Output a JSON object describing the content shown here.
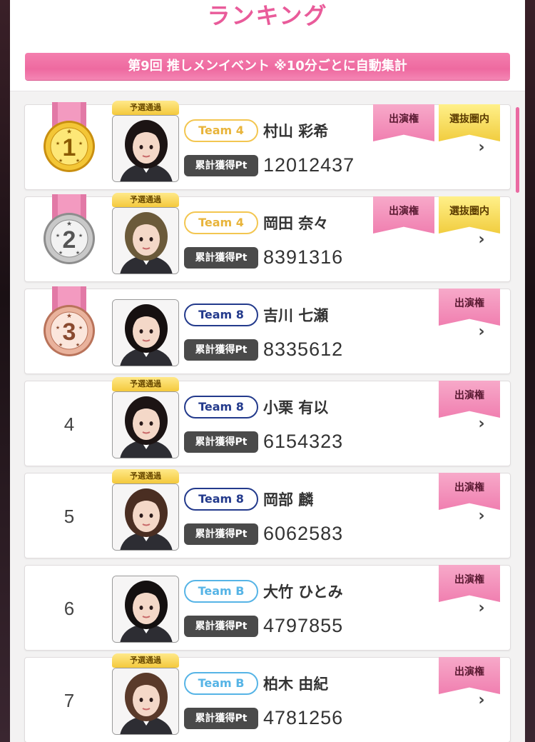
{
  "header": {
    "title": "ランキング",
    "event_label": "第9回 推しメンイベント ※10分ごとに自動集計"
  },
  "pt_label": "累計獲得Pt",
  "colors": {
    "accent": "#e95b9a",
    "team4": "#f3c650",
    "team8": "#233a8c",
    "teamB": "#56b4e6"
  },
  "rankings": [
    {
      "rank": "1",
      "medal": "gold",
      "qualified": true,
      "qualified_label": "予選通過",
      "team": "Team 4",
      "team_color": "#f3c650",
      "team_text_color": "#e8b43a",
      "name": "村山 彩希",
      "points": "12012437",
      "badges": [
        "出演権",
        "選抜圏内"
      ]
    },
    {
      "rank": "2",
      "medal": "silver",
      "qualified": true,
      "qualified_label": "予選通過",
      "team": "Team 4",
      "team_color": "#f3c650",
      "team_text_color": "#e8b43a",
      "name": "岡田 奈々",
      "points": "8391316",
      "badges": [
        "出演権",
        "選抜圏内"
      ]
    },
    {
      "rank": "3",
      "medal": "bronze",
      "qualified": false,
      "qualified_label": "",
      "team": "Team 8",
      "team_color": "#233a8c",
      "team_text_color": "#233a8c",
      "name": "吉川 七瀬",
      "points": "8335612",
      "badges": [
        "出演権"
      ]
    },
    {
      "rank": "4",
      "medal": "",
      "qualified": true,
      "qualified_label": "予選通過",
      "team": "Team 8",
      "team_color": "#233a8c",
      "team_text_color": "#233a8c",
      "name": "小栗 有以",
      "points": "6154323",
      "badges": [
        "出演権"
      ]
    },
    {
      "rank": "5",
      "medal": "",
      "qualified": true,
      "qualified_label": "予選通過",
      "team": "Team 8",
      "team_color": "#233a8c",
      "team_text_color": "#233a8c",
      "name": "岡部 麟",
      "points": "6062583",
      "badges": [
        "出演権"
      ]
    },
    {
      "rank": "6",
      "medal": "",
      "qualified": false,
      "qualified_label": "",
      "team": "Team B",
      "team_color": "#56b4e6",
      "team_text_color": "#56b4e6",
      "name": "大竹 ひとみ",
      "points": "4797855",
      "badges": [
        "出演権"
      ]
    },
    {
      "rank": "7",
      "medal": "",
      "qualified": true,
      "qualified_label": "予選通過",
      "team": "Team B",
      "team_color": "#56b4e6",
      "team_text_color": "#56b4e6",
      "name": "柏木 由紀",
      "points": "4781256",
      "badges": [
        "出演権"
      ]
    }
  ]
}
